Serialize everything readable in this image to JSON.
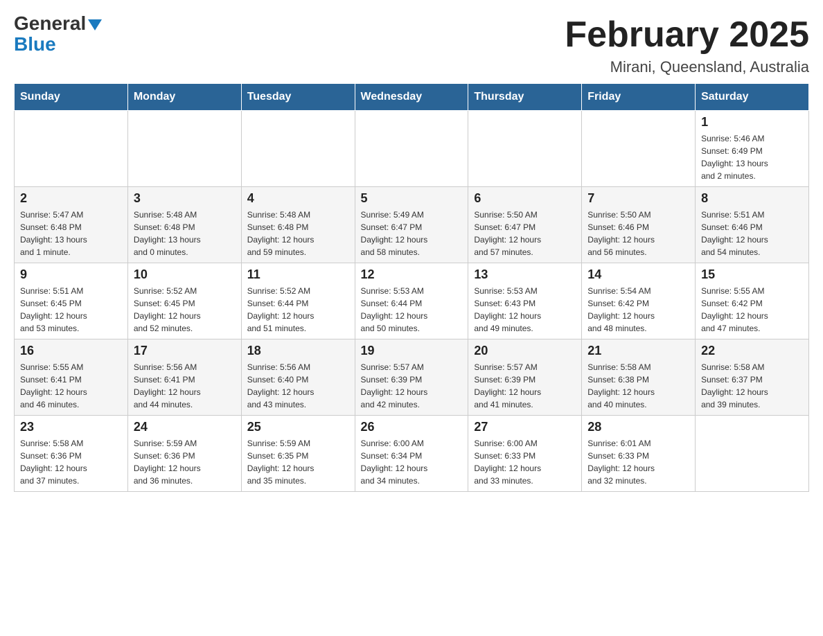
{
  "header": {
    "logo_general": "General",
    "logo_blue": "Blue",
    "title": "February 2025",
    "subtitle": "Mirani, Queensland, Australia"
  },
  "days_of_week": [
    "Sunday",
    "Monday",
    "Tuesday",
    "Wednesday",
    "Thursday",
    "Friday",
    "Saturday"
  ],
  "weeks": [
    [
      {
        "day": "",
        "info": ""
      },
      {
        "day": "",
        "info": ""
      },
      {
        "day": "",
        "info": ""
      },
      {
        "day": "",
        "info": ""
      },
      {
        "day": "",
        "info": ""
      },
      {
        "day": "",
        "info": ""
      },
      {
        "day": "1",
        "info": "Sunrise: 5:46 AM\nSunset: 6:49 PM\nDaylight: 13 hours\nand 2 minutes."
      }
    ],
    [
      {
        "day": "2",
        "info": "Sunrise: 5:47 AM\nSunset: 6:48 PM\nDaylight: 13 hours\nand 1 minute."
      },
      {
        "day": "3",
        "info": "Sunrise: 5:48 AM\nSunset: 6:48 PM\nDaylight: 13 hours\nand 0 minutes."
      },
      {
        "day": "4",
        "info": "Sunrise: 5:48 AM\nSunset: 6:48 PM\nDaylight: 12 hours\nand 59 minutes."
      },
      {
        "day": "5",
        "info": "Sunrise: 5:49 AM\nSunset: 6:47 PM\nDaylight: 12 hours\nand 58 minutes."
      },
      {
        "day": "6",
        "info": "Sunrise: 5:50 AM\nSunset: 6:47 PM\nDaylight: 12 hours\nand 57 minutes."
      },
      {
        "day": "7",
        "info": "Sunrise: 5:50 AM\nSunset: 6:46 PM\nDaylight: 12 hours\nand 56 minutes."
      },
      {
        "day": "8",
        "info": "Sunrise: 5:51 AM\nSunset: 6:46 PM\nDaylight: 12 hours\nand 54 minutes."
      }
    ],
    [
      {
        "day": "9",
        "info": "Sunrise: 5:51 AM\nSunset: 6:45 PM\nDaylight: 12 hours\nand 53 minutes."
      },
      {
        "day": "10",
        "info": "Sunrise: 5:52 AM\nSunset: 6:45 PM\nDaylight: 12 hours\nand 52 minutes."
      },
      {
        "day": "11",
        "info": "Sunrise: 5:52 AM\nSunset: 6:44 PM\nDaylight: 12 hours\nand 51 minutes."
      },
      {
        "day": "12",
        "info": "Sunrise: 5:53 AM\nSunset: 6:44 PM\nDaylight: 12 hours\nand 50 minutes."
      },
      {
        "day": "13",
        "info": "Sunrise: 5:53 AM\nSunset: 6:43 PM\nDaylight: 12 hours\nand 49 minutes."
      },
      {
        "day": "14",
        "info": "Sunrise: 5:54 AM\nSunset: 6:42 PM\nDaylight: 12 hours\nand 48 minutes."
      },
      {
        "day": "15",
        "info": "Sunrise: 5:55 AM\nSunset: 6:42 PM\nDaylight: 12 hours\nand 47 minutes."
      }
    ],
    [
      {
        "day": "16",
        "info": "Sunrise: 5:55 AM\nSunset: 6:41 PM\nDaylight: 12 hours\nand 46 minutes."
      },
      {
        "day": "17",
        "info": "Sunrise: 5:56 AM\nSunset: 6:41 PM\nDaylight: 12 hours\nand 44 minutes."
      },
      {
        "day": "18",
        "info": "Sunrise: 5:56 AM\nSunset: 6:40 PM\nDaylight: 12 hours\nand 43 minutes."
      },
      {
        "day": "19",
        "info": "Sunrise: 5:57 AM\nSunset: 6:39 PM\nDaylight: 12 hours\nand 42 minutes."
      },
      {
        "day": "20",
        "info": "Sunrise: 5:57 AM\nSunset: 6:39 PM\nDaylight: 12 hours\nand 41 minutes."
      },
      {
        "day": "21",
        "info": "Sunrise: 5:58 AM\nSunset: 6:38 PM\nDaylight: 12 hours\nand 40 minutes."
      },
      {
        "day": "22",
        "info": "Sunrise: 5:58 AM\nSunset: 6:37 PM\nDaylight: 12 hours\nand 39 minutes."
      }
    ],
    [
      {
        "day": "23",
        "info": "Sunrise: 5:58 AM\nSunset: 6:36 PM\nDaylight: 12 hours\nand 37 minutes."
      },
      {
        "day": "24",
        "info": "Sunrise: 5:59 AM\nSunset: 6:36 PM\nDaylight: 12 hours\nand 36 minutes."
      },
      {
        "day": "25",
        "info": "Sunrise: 5:59 AM\nSunset: 6:35 PM\nDaylight: 12 hours\nand 35 minutes."
      },
      {
        "day": "26",
        "info": "Sunrise: 6:00 AM\nSunset: 6:34 PM\nDaylight: 12 hours\nand 34 minutes."
      },
      {
        "day": "27",
        "info": "Sunrise: 6:00 AM\nSunset: 6:33 PM\nDaylight: 12 hours\nand 33 minutes."
      },
      {
        "day": "28",
        "info": "Sunrise: 6:01 AM\nSunset: 6:33 PM\nDaylight: 12 hours\nand 32 minutes."
      },
      {
        "day": "",
        "info": ""
      }
    ]
  ]
}
